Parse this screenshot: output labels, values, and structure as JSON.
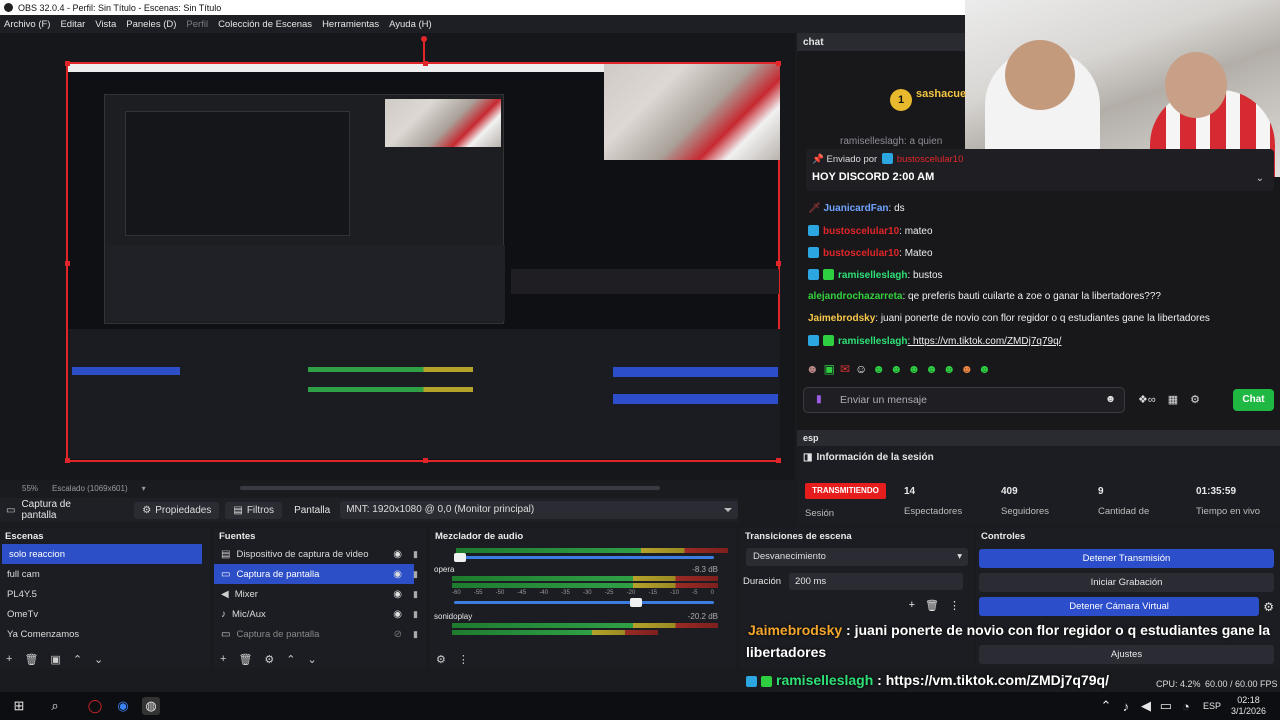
{
  "window": {
    "title": "OBS 32.0.4 - Perfil: Sin Título - Escenas: Sin Título"
  },
  "menu": [
    {
      "label": "Archivo (F)",
      "dim": false
    },
    {
      "label": "Editar",
      "dim": false
    },
    {
      "label": "Vista",
      "dim": false
    },
    {
      "label": "Paneles (D)",
      "dim": false
    },
    {
      "label": "Perfil",
      "dim": true
    },
    {
      "label": "Colección de Escenas",
      "dim": false
    },
    {
      "label": "Herramientas",
      "dim": false
    },
    {
      "label": "Ayuda (H)",
      "dim": false
    }
  ],
  "preview": {
    "zoom": "55%",
    "scaling": "Escalado (1069x601)"
  },
  "source_toolbar": {
    "current_source": "Captura de pantalla",
    "properties": "Propiedades",
    "filters": "Filtros",
    "display_label": "Pantalla",
    "display_value": "MNT: 1920x1080 @ 0,0 (Monitor principal)"
  },
  "scenes": {
    "title": "Escenas",
    "items": [
      {
        "label": "solo reaccion",
        "selected": true
      },
      {
        "label": "full cam",
        "selected": false
      },
      {
        "label": "PL4Y.5",
        "selected": false
      },
      {
        "label": "OmeTv",
        "selected": false
      },
      {
        "label": "Ya Comenzamos",
        "selected": false
      }
    ]
  },
  "sources": {
    "title": "Fuentes",
    "items": [
      {
        "label": "Dispositivo de captura de video",
        "icon": "camera-icon",
        "selected": false,
        "visible": true
      },
      {
        "label": "Captura de pantalla",
        "icon": "monitor-icon",
        "selected": true,
        "visible": true
      },
      {
        "label": "Mixer",
        "icon": "speaker-icon",
        "selected": false,
        "visible": true
      },
      {
        "label": "Mic/Aux",
        "icon": "mic-icon",
        "selected": false,
        "visible": true
      },
      {
        "label": "Captura de pantalla",
        "icon": "monitor-icon",
        "selected": false,
        "visible": false
      }
    ]
  },
  "mixer": {
    "title": "Mezclador de audio",
    "ticks": [
      "-60",
      "-55",
      "-50",
      "-45",
      "-40",
      "-35",
      "-30",
      "-25",
      "-20",
      "-15",
      "-10",
      "-5",
      "0"
    ],
    "channels": [
      {
        "name": "",
        "db": "",
        "level": 0.7
      },
      {
        "name": "opera",
        "db": "-8.3 dB",
        "level": 0.75
      },
      {
        "name": "sonidoplay",
        "db": "-20.2 dB",
        "level": 0.65
      }
    ]
  },
  "transitions": {
    "title": "Transiciones de escena",
    "selected": "Desvanecimiento",
    "duration_label": "Duración",
    "duration_value": "200 ms"
  },
  "controls": {
    "title": "Controles",
    "stop_stream": "Detener Transmisión",
    "start_record": "Iniciar Grabación",
    "stop_vcam": "Detener Cámara Virtual",
    "settings": "Ajustes"
  },
  "chat": {
    "header": "chat",
    "top_gifter": "sashacue",
    "pinned_by_label": "Enviado por",
    "pinned_by_user": "bustoscelular10",
    "pinned_text": "HOY DISCORD 2:00 AM",
    "partial": "ramiselleslagh: a quien",
    "messages": [
      {
        "user": "JuanicardFan",
        "text": ": ds",
        "color": "#6fa3ff"
      },
      {
        "user": "bustoscelular10",
        "text": ": mateo",
        "color": "#e1262a"
      },
      {
        "user": "bustoscelular10",
        "text": ": Mateo",
        "color": "#e1262a"
      },
      {
        "user": "ramiselleslagh",
        "text": ": bustos",
        "color": "#2ee076"
      },
      {
        "user": "alejandrochazarreta",
        "text": ": qe preferis bauti cuilarte a zoe o ganar la libertadores???",
        "color": "#34d13d"
      },
      {
        "user": "Jaimebrodsky",
        "text": ": juani ponerte de novio con flor regidor o q estudiantes gane la libertadores",
        "color": "#f7c84a"
      },
      {
        "user": "ramiselleslagh",
        "text": ": https://vm.tiktok.com/ZMDj7q79q/",
        "color": "#2ee076"
      }
    ],
    "input_placeholder": "Enviar un mensaje",
    "send_label": "Chat"
  },
  "session": {
    "header": "esp",
    "title": "Información de la sesión",
    "live_label": "TRANSMITIENDO",
    "live_sub": "Sesión",
    "stats": [
      {
        "value": "14",
        "label": "Espectadores"
      },
      {
        "value": "409",
        "label": "Seguidores"
      },
      {
        "value": "9",
        "label": "Cantidad de"
      },
      {
        "value": "01:35:59",
        "label": "Tiempo en vivo"
      }
    ]
  },
  "overlay": {
    "line1_user": "Jaimebrodsky",
    "line1_text": " : juani ponerte de novio con flor regidor o q estudiantes gane la",
    "line2_text": "libertadores",
    "line3_user": "ramiselleslagh",
    "line3_text": " : https://vm.tiktok.com/ZMDj7q79q/"
  },
  "statusbar": {
    "cpu": "CPU: 4.2%",
    "fps": "60.00 / 60.00 FPS"
  },
  "taskbar": {
    "lang": "ESP",
    "time": "02:18",
    "date": "3/1/2026"
  },
  "colors": {
    "accent": "#2c4fc7",
    "red": "#e1262a",
    "green": "#1fb843"
  }
}
